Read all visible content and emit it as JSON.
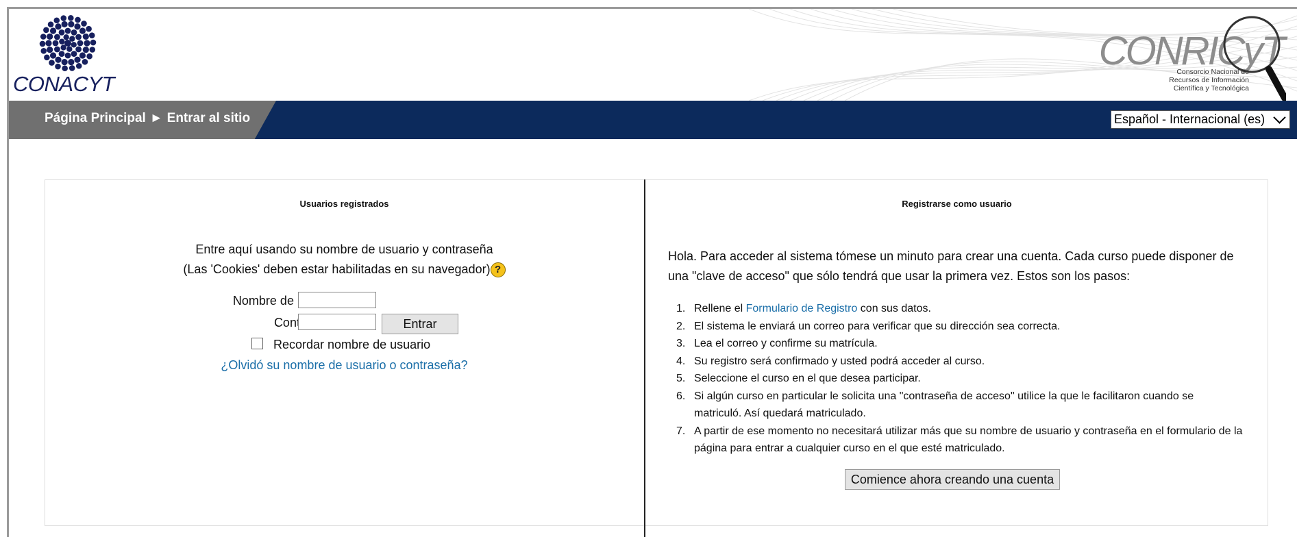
{
  "header": {
    "left_logo_text": "CONACYT",
    "right_logo_title": "CONRICyT",
    "right_logo_subtitle": [
      "Consorcio Nacional de",
      "Recursos de Información",
      "Científica y Tecnológica"
    ]
  },
  "nav": {
    "breadcrumb_home": "Página Principal",
    "breadcrumb_separator": "►",
    "breadcrumb_current": "Entrar al sitio",
    "language_selected": "Español - Internacional (es)"
  },
  "login": {
    "title": "Usuarios registrados",
    "intro_line1": "Entre aquí usando su nombre de usuario y contraseña",
    "intro_line2": "(Las 'Cookies' deben estar habilitadas en su navegador)",
    "help_icon": "?",
    "username_label": "Nombre de usuario",
    "username_value": "",
    "password_label": "Contraseña",
    "password_value": "",
    "submit_label": "Entrar",
    "remember_label": "Recordar nombre de usuario",
    "forgot_link": "¿Olvidó su nombre de usuario o contraseña?"
  },
  "signup": {
    "title": "Registrarse como usuario",
    "paragraph": "Hola. Para acceder al sistema tómese un minuto para crear una cuenta. Cada curso puede disponer de una \"clave de acceso\" que sólo tendrá que usar la primera vez. Estos son los pasos:",
    "steps": [
      {
        "num": "1.",
        "before": "Rellene el ",
        "link": "Formulario de Registro",
        "after": " con sus datos."
      },
      {
        "num": "2.",
        "before": "El sistema le enviará un correo para verificar que su dirección sea correcta.",
        "link": "",
        "after": ""
      },
      {
        "num": "3.",
        "before": "Lea el correo y confirme su matrícula.",
        "link": "",
        "after": ""
      },
      {
        "num": "4.",
        "before": "Su registro será confirmado y usted podrá acceder al curso.",
        "link": "",
        "after": ""
      },
      {
        "num": "5.",
        "before": "Seleccione el curso en el que desea participar.",
        "link": "",
        "after": ""
      },
      {
        "num": "6.",
        "before": "Si algún curso en particular le solicita una \"contraseña de acceso\" utilice la que le facilitaron cuando se matriculó. Así quedará matriculado.",
        "link": "",
        "after": ""
      },
      {
        "num": "7.",
        "before": "A partir de ese momento no necesitará utilizar más que su nombre de usuario y contraseña en el formulario de la página para entrar a cualquier curso en el que esté matriculado.",
        "link": "",
        "after": ""
      }
    ],
    "create_button": "Comience ahora creando una cuenta"
  }
}
